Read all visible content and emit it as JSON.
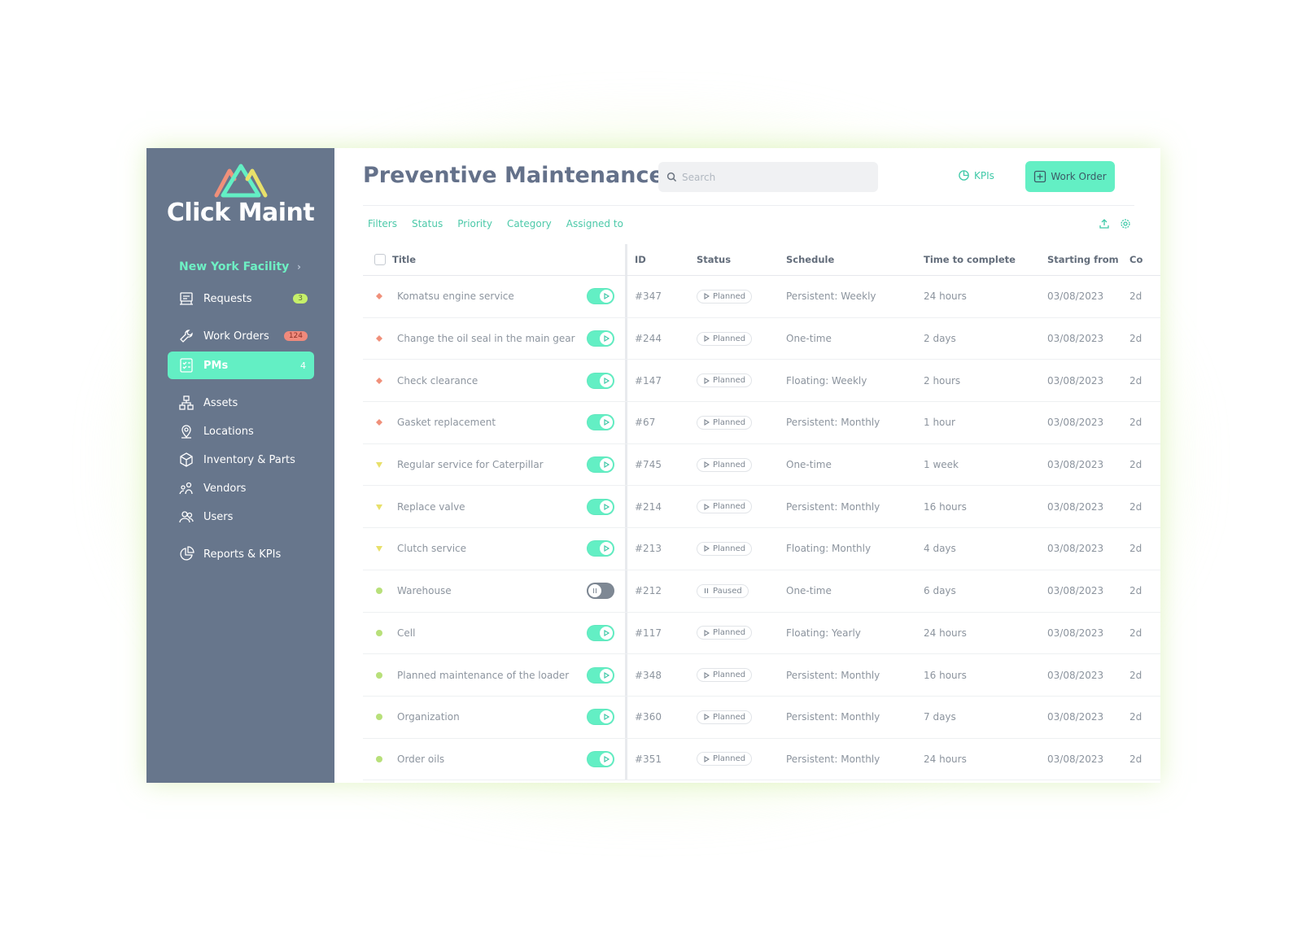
{
  "app": {
    "brand": "Click Maint",
    "facility": "New York Facility"
  },
  "sidebar": {
    "items": [
      {
        "label": "Requests",
        "icon": "requests-icon",
        "badge": "3",
        "badge_color": "#c6f06a"
      },
      {
        "label": "Work Orders",
        "icon": "wrench-icon",
        "badge": "124",
        "badge_color": "#f08a7c"
      },
      {
        "label": "PMs",
        "icon": "checklist-icon",
        "count": "4",
        "active": true
      },
      {
        "label": "Assets",
        "icon": "hierarchy-icon"
      },
      {
        "label": "Locations",
        "icon": "map-pin-icon"
      },
      {
        "label": "Inventory & Parts",
        "icon": "box-icon"
      },
      {
        "label": "Vendors",
        "icon": "vendor-icon"
      },
      {
        "label": "Users",
        "icon": "users-icon"
      },
      {
        "label": "Reports & KPIs",
        "icon": "pie-chart-icon"
      }
    ]
  },
  "header": {
    "title": "Preventive Maintenance",
    "search_placeholder": "Search",
    "kpis_label": "KPIs",
    "work_order_label": "Work Order"
  },
  "filters": [
    "Filters",
    "Status",
    "Priority",
    "Category",
    "Assigned to"
  ],
  "table": {
    "columns": {
      "title": "Title",
      "id": "ID",
      "status": "Status",
      "schedule": "Schedule",
      "time": "Time to complete",
      "start": "Starting from",
      "extra": "Co"
    },
    "rows": [
      {
        "title": "Komatsu engine service",
        "priority": "high",
        "enabled": true,
        "id": "#347",
        "status": "Planned",
        "schedule": "Persistent: Weekly",
        "time": "24 hours",
        "start": "03/08/2023",
        "extra": "2d"
      },
      {
        "title": "Change the oil seal in the main gear",
        "priority": "high",
        "enabled": true,
        "id": "#244",
        "status": "Planned",
        "schedule": "One-time",
        "time": "2 days",
        "start": "03/08/2023",
        "extra": "2d"
      },
      {
        "title": "Check clearance",
        "priority": "high",
        "enabled": true,
        "id": "#147",
        "status": "Planned",
        "schedule": "Floating: Weekly",
        "time": "2 hours",
        "start": "03/08/2023",
        "extra": "2d"
      },
      {
        "title": "Gasket replacement",
        "priority": "high",
        "enabled": true,
        "id": "#67",
        "status": "Planned",
        "schedule": "Persistent: Monthly",
        "time": "1 hour",
        "start": "03/08/2023",
        "extra": "2d"
      },
      {
        "title": "Regular service for Caterpillar",
        "priority": "medium",
        "enabled": true,
        "id": "#745",
        "status": "Planned",
        "schedule": "One-time",
        "time": "1 week",
        "start": "03/08/2023",
        "extra": "2d"
      },
      {
        "title": "Replace valve",
        "priority": "medium",
        "enabled": true,
        "id": "#214",
        "status": "Planned",
        "schedule": "Persistent: Monthly",
        "time": "16 hours",
        "start": "03/08/2023",
        "extra": "2d"
      },
      {
        "title": "Clutch service",
        "priority": "medium",
        "enabled": true,
        "id": "#213",
        "status": "Planned",
        "schedule": "Floating: Monthly",
        "time": "4 days",
        "start": "03/08/2023",
        "extra": "2d"
      },
      {
        "title": "Warehouse",
        "priority": "low",
        "enabled": false,
        "id": "#212",
        "status": "Paused",
        "schedule": "One-time",
        "time": "6 days",
        "start": "03/08/2023",
        "extra": "2d"
      },
      {
        "title": "Cell",
        "priority": "low",
        "enabled": true,
        "id": "#117",
        "status": "Planned",
        "schedule": "Floating: Yearly",
        "time": "24 hours",
        "start": "03/08/2023",
        "extra": "2d"
      },
      {
        "title": "Planned maintenance of the loader",
        "priority": "low",
        "enabled": true,
        "id": "#348",
        "status": "Planned",
        "schedule": "Persistent: Monthly",
        "time": "16 hours",
        "start": "03/08/2023",
        "extra": "2d"
      },
      {
        "title": "Organization",
        "priority": "low",
        "enabled": true,
        "id": "#360",
        "status": "Planned",
        "schedule": "Persistent: Monthly",
        "time": "7 days",
        "start": "03/08/2023",
        "extra": "2d"
      },
      {
        "title": "Order oils",
        "priority": "low",
        "enabled": true,
        "id": "#351",
        "status": "Planned",
        "schedule": "Persistent: Monthly",
        "time": "24 hours",
        "start": "03/08/2023",
        "extra": "2d"
      }
    ]
  },
  "colors": {
    "sidebar_bg": "#67768c",
    "accent": "#63efc4",
    "priority_high": "#f0907a",
    "priority_medium": "#e8e06a",
    "priority_low": "#b8e07a"
  }
}
